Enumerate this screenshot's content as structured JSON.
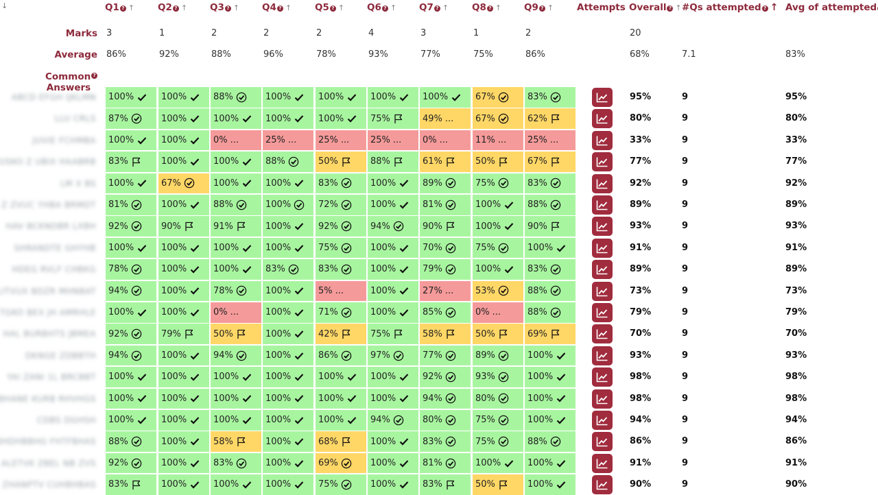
{
  "header": {
    "corner_sort": "↓",
    "questions": [
      "Q1",
      "Q2",
      "Q3",
      "Q4",
      "Q5",
      "Q6",
      "Q7",
      "Q8",
      "Q9"
    ],
    "info_glyph": "?",
    "sort_glyph": "↑",
    "attempts": "Attempts",
    "overall": "Overall",
    "qs_attempted": "#Qs attempted",
    "avg_attempted": "Avg of attempted"
  },
  "marks_row": {
    "label": "Marks",
    "values": [
      "3",
      "1",
      "2",
      "2",
      "2",
      "4",
      "3",
      "1",
      "2"
    ],
    "overall": "20"
  },
  "average_row": {
    "label": "Average",
    "values": [
      "86%",
      "92%",
      "88%",
      "96%",
      "78%",
      "93%",
      "77%",
      "75%",
      "86%"
    ],
    "overall": "68%",
    "qs_attempted": "7.1",
    "avg_attempted": "83%"
  },
  "common_answers": {
    "label": "Common Answers"
  },
  "students": [
    {
      "name": "ABCD EFGH IJKLMN",
      "cells": [
        [
          "100%",
          "check",
          "g"
        ],
        [
          "100%",
          "check",
          "g"
        ],
        [
          "88%",
          "circle",
          "g"
        ],
        [
          "100%",
          "check",
          "g"
        ],
        [
          "100%",
          "check",
          "g"
        ],
        [
          "100%",
          "check",
          "g"
        ],
        [
          "100%",
          "check",
          "g"
        ],
        [
          "67%",
          "circle",
          "y"
        ],
        [
          "83%",
          "circle",
          "g"
        ]
      ],
      "overall": "95%",
      "qs": "9",
      "avg": "95%"
    },
    {
      "name": "LLU CRLS",
      "cells": [
        [
          "87%",
          "circle",
          "g"
        ],
        [
          "100%",
          "check",
          "g"
        ],
        [
          "100%",
          "check",
          "g"
        ],
        [
          "100%",
          "check",
          "g"
        ],
        [
          "100%",
          "check",
          "g"
        ],
        [
          "75%",
          "flag",
          "g"
        ],
        [
          "49%",
          "dots",
          "y"
        ],
        [
          "67%",
          "circle",
          "y"
        ],
        [
          "62%",
          "flag",
          "y"
        ]
      ],
      "overall": "80%",
      "qs": "9",
      "avg": "80%"
    },
    {
      "name": "JUVIE FCHMBA",
      "cells": [
        [
          "100%",
          "check",
          "g"
        ],
        [
          "100%",
          "check",
          "g"
        ],
        [
          "0%",
          "dots",
          "r"
        ],
        [
          "25%",
          "dots",
          "r"
        ],
        [
          "25%",
          "dots",
          "r"
        ],
        [
          "25%",
          "dots",
          "r"
        ],
        [
          "0%",
          "dots",
          "r"
        ],
        [
          "11%",
          "dots",
          "r"
        ],
        [
          "25%",
          "dots",
          "r"
        ]
      ],
      "overall": "33%",
      "qs": "9",
      "avg": "33%"
    },
    {
      "name": "PUSKO Z UBIX HAABRB",
      "cells": [
        [
          "83%",
          "flag",
          "g"
        ],
        [
          "100%",
          "check",
          "g"
        ],
        [
          "100%",
          "check",
          "g"
        ],
        [
          "88%",
          "circle",
          "g"
        ],
        [
          "50%",
          "flag",
          "y"
        ],
        [
          "88%",
          "flag",
          "g"
        ],
        [
          "61%",
          "flag",
          "y"
        ],
        [
          "50%",
          "flag",
          "y"
        ],
        [
          "67%",
          "flag",
          "y"
        ]
      ],
      "overall": "77%",
      "qs": "9",
      "avg": "77%"
    },
    {
      "name": "LM X BS",
      "cells": [
        [
          "100%",
          "check",
          "g"
        ],
        [
          "67%",
          "circle",
          "y"
        ],
        [
          "100%",
          "check",
          "g"
        ],
        [
          "100%",
          "check",
          "g"
        ],
        [
          "83%",
          "circle",
          "g"
        ],
        [
          "100%",
          "check",
          "g"
        ],
        [
          "89%",
          "circle",
          "g"
        ],
        [
          "75%",
          "circle",
          "g"
        ],
        [
          "83%",
          "circle",
          "g"
        ]
      ],
      "overall": "92%",
      "qs": "9",
      "avg": "92%"
    },
    {
      "name": "Z ZVUC YHBA BRMDT",
      "cells": [
        [
          "81%",
          "circle",
          "g"
        ],
        [
          "100%",
          "check",
          "g"
        ],
        [
          "88%",
          "circle",
          "g"
        ],
        [
          "100%",
          "circle",
          "g"
        ],
        [
          "72%",
          "circle",
          "g"
        ],
        [
          "100%",
          "check",
          "g"
        ],
        [
          "81%",
          "circle",
          "g"
        ],
        [
          "100%",
          "check",
          "g"
        ],
        [
          "88%",
          "circle",
          "g"
        ]
      ],
      "overall": "89%",
      "qs": "9",
      "avg": "89%"
    },
    {
      "name": "HAV BCKNDBR LXBH",
      "cells": [
        [
          "92%",
          "circle",
          "g"
        ],
        [
          "90%",
          "flag",
          "g"
        ],
        [
          "91%",
          "flag",
          "g"
        ],
        [
          "100%",
          "check",
          "g"
        ],
        [
          "92%",
          "circle",
          "g"
        ],
        [
          "94%",
          "circle",
          "g"
        ],
        [
          "90%",
          "flag",
          "g"
        ],
        [
          "100%",
          "check",
          "g"
        ],
        [
          "90%",
          "flag",
          "g"
        ]
      ],
      "overall": "93%",
      "qs": "9",
      "avg": "93%"
    },
    {
      "name": "SHRANDTE GHYHB",
      "cells": [
        [
          "100%",
          "check",
          "g"
        ],
        [
          "100%",
          "check",
          "g"
        ],
        [
          "100%",
          "check",
          "g"
        ],
        [
          "100%",
          "check",
          "g"
        ],
        [
          "75%",
          "circle",
          "g"
        ],
        [
          "100%",
          "check",
          "g"
        ],
        [
          "70%",
          "circle",
          "g"
        ],
        [
          "75%",
          "circle",
          "g"
        ],
        [
          "100%",
          "check",
          "g"
        ]
      ],
      "overall": "91%",
      "qs": "9",
      "avg": "91%"
    },
    {
      "name": "HDEG RVLF CHBKG",
      "cells": [
        [
          "78%",
          "circle",
          "g"
        ],
        [
          "100%",
          "check",
          "g"
        ],
        [
          "100%",
          "check",
          "g"
        ],
        [
          "83%",
          "circle",
          "g"
        ],
        [
          "83%",
          "circle",
          "g"
        ],
        [
          "100%",
          "check",
          "g"
        ],
        [
          "79%",
          "circle",
          "g"
        ],
        [
          "100%",
          "check",
          "g"
        ],
        [
          "83%",
          "circle",
          "g"
        ]
      ],
      "overall": "89%",
      "qs": "9",
      "avg": "89%"
    },
    {
      "name": "LITVUX BDZR MHNBAT",
      "cells": [
        [
          "94%",
          "circle",
          "g"
        ],
        [
          "100%",
          "check",
          "g"
        ],
        [
          "78%",
          "circle",
          "g"
        ],
        [
          "100%",
          "check",
          "g"
        ],
        [
          "5%",
          "dots",
          "r"
        ],
        [
          "100%",
          "check",
          "g"
        ],
        [
          "27%",
          "dots",
          "r"
        ],
        [
          "53%",
          "circle",
          "y"
        ],
        [
          "88%",
          "circle",
          "g"
        ]
      ],
      "overall": "73%",
      "qs": "9",
      "avg": "73%"
    },
    {
      "name": "TGKO BEX JH AMRHLE",
      "cells": [
        [
          "100%",
          "check",
          "g"
        ],
        [
          "100%",
          "check",
          "g"
        ],
        [
          "0%",
          "dots",
          "r"
        ],
        [
          "100%",
          "check",
          "g"
        ],
        [
          "71%",
          "circle",
          "g"
        ],
        [
          "100%",
          "check",
          "g"
        ],
        [
          "85%",
          "circle",
          "g"
        ],
        [
          "0%",
          "dots",
          "r"
        ],
        [
          "88%",
          "circle",
          "g"
        ]
      ],
      "overall": "79%",
      "qs": "9",
      "avg": "79%"
    },
    {
      "name": "HAL BURBHTS JBMEA",
      "cells": [
        [
          "92%",
          "circle",
          "g"
        ],
        [
          "79%",
          "flag",
          "g"
        ],
        [
          "50%",
          "flag",
          "y"
        ],
        [
          "100%",
          "check",
          "g"
        ],
        [
          "42%",
          "flag",
          "y"
        ],
        [
          "75%",
          "flag",
          "g"
        ],
        [
          "58%",
          "flag",
          "y"
        ],
        [
          "50%",
          "flag",
          "y"
        ],
        [
          "69%",
          "flag",
          "y"
        ]
      ],
      "overall": "70%",
      "qs": "9",
      "avg": "70%"
    },
    {
      "name": "DKNGE ZDBBTH",
      "cells": [
        [
          "94%",
          "circle",
          "g"
        ],
        [
          "100%",
          "check",
          "g"
        ],
        [
          "94%",
          "circle",
          "g"
        ],
        [
          "100%",
          "check",
          "g"
        ],
        [
          "86%",
          "circle",
          "g"
        ],
        [
          "97%",
          "circle",
          "g"
        ],
        [
          "77%",
          "circle",
          "g"
        ],
        [
          "89%",
          "circle",
          "g"
        ],
        [
          "100%",
          "check",
          "g"
        ]
      ],
      "overall": "93%",
      "qs": "9",
      "avg": "93%"
    },
    {
      "name": "YAI ZANI 1L BRCBBT",
      "cells": [
        [
          "100%",
          "check",
          "g"
        ],
        [
          "100%",
          "check",
          "g"
        ],
        [
          "100%",
          "check",
          "g"
        ],
        [
          "100%",
          "check",
          "g"
        ],
        [
          "100%",
          "check",
          "g"
        ],
        [
          "100%",
          "check",
          "g"
        ],
        [
          "92%",
          "circle",
          "g"
        ],
        [
          "93%",
          "circle",
          "g"
        ],
        [
          "100%",
          "check",
          "g"
        ]
      ],
      "overall": "98%",
      "qs": "9",
      "avg": "98%"
    },
    {
      "name": "BHANE KURB RHVHGS",
      "cells": [
        [
          "100%",
          "check",
          "g"
        ],
        [
          "100%",
          "check",
          "g"
        ],
        [
          "100%",
          "check",
          "g"
        ],
        [
          "100%",
          "check",
          "g"
        ],
        [
          "100%",
          "check",
          "g"
        ],
        [
          "100%",
          "check",
          "g"
        ],
        [
          "94%",
          "circle",
          "g"
        ],
        [
          "80%",
          "circle",
          "g"
        ],
        [
          "100%",
          "check",
          "g"
        ]
      ],
      "overall": "98%",
      "qs": "9",
      "avg": "98%"
    },
    {
      "name": "CDBS DGHSH",
      "cells": [
        [
          "100%",
          "check",
          "g"
        ],
        [
          "100%",
          "check",
          "g"
        ],
        [
          "100%",
          "check",
          "g"
        ],
        [
          "100%",
          "check",
          "g"
        ],
        [
          "100%",
          "check",
          "g"
        ],
        [
          "94%",
          "circle",
          "g"
        ],
        [
          "80%",
          "circle",
          "g"
        ],
        [
          "75%",
          "circle",
          "g"
        ],
        [
          "100%",
          "check",
          "g"
        ]
      ],
      "overall": "94%",
      "qs": "9",
      "avg": "94%"
    },
    {
      "name": "BHDHBBHG FHTFBHAS",
      "cells": [
        [
          "88%",
          "circle",
          "g"
        ],
        [
          "100%",
          "check",
          "g"
        ],
        [
          "58%",
          "flag",
          "y"
        ],
        [
          "100%",
          "check",
          "g"
        ],
        [
          "68%",
          "flag",
          "y"
        ],
        [
          "100%",
          "check",
          "g"
        ],
        [
          "83%",
          "circle",
          "g"
        ],
        [
          "75%",
          "circle",
          "g"
        ],
        [
          "88%",
          "circle",
          "g"
        ]
      ],
      "overall": "86%",
      "qs": "9",
      "avg": "86%"
    },
    {
      "name": "ALETVK ZBEL NB ZVS",
      "cells": [
        [
          "92%",
          "circle",
          "g"
        ],
        [
          "100%",
          "check",
          "g"
        ],
        [
          "83%",
          "circle",
          "g"
        ],
        [
          "100%",
          "check",
          "g"
        ],
        [
          "69%",
          "circle",
          "y"
        ],
        [
          "100%",
          "check",
          "g"
        ],
        [
          "81%",
          "circle",
          "g"
        ],
        [
          "100%",
          "check",
          "g"
        ],
        [
          "100%",
          "check",
          "g"
        ]
      ],
      "overall": "91%",
      "qs": "9",
      "avg": "91%"
    },
    {
      "name": "ZHANPTV CUHBHBAS",
      "cells": [
        [
          "83%",
          "flag",
          "g"
        ],
        [
          "100%",
          "check",
          "g"
        ],
        [
          "100%",
          "check",
          "g"
        ],
        [
          "100%",
          "check",
          "g"
        ],
        [
          "75%",
          "circle",
          "g"
        ],
        [
          "100%",
          "check",
          "g"
        ],
        [
          "83%",
          "flag",
          "g"
        ],
        [
          "50%",
          "flag",
          "y"
        ],
        [
          "100%",
          "check",
          "g"
        ]
      ],
      "overall": "90%",
      "qs": "9",
      "avg": "90%"
    }
  ],
  "icons": {
    "check": "check-icon",
    "circle": "circled-check-icon",
    "flag": "flag-icon",
    "dots": "ellipsis",
    "attempts_button": "chart-line-icon"
  },
  "colors": {
    "accent": "#8d2a3c",
    "button": "#a02c3e",
    "green": "#a8f5a0",
    "yellow": "#ffd766",
    "red": "#f59a9a"
  }
}
